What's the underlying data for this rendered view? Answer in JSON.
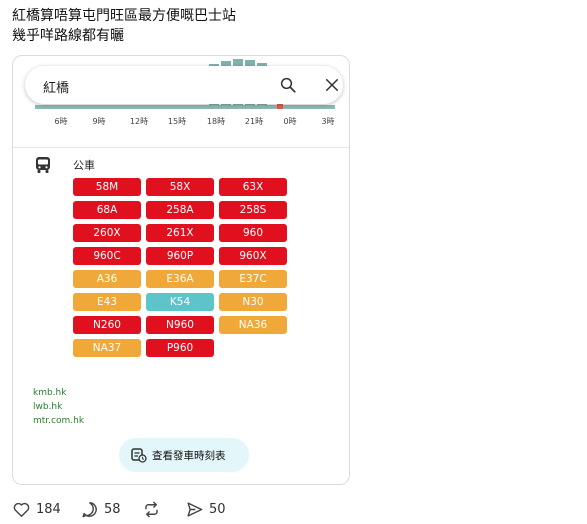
{
  "post": {
    "line1": "紅橋算唔算屯門旺區最方便嘅巴士站",
    "line2": "幾乎咩路線都有曬"
  },
  "map_card": {
    "search": {
      "value": "紅橋"
    },
    "busy_times": {
      "ticks": [
        "6時",
        "9時",
        "12時",
        "15時",
        "18時",
        "21時",
        "0時",
        "3時"
      ]
    },
    "transit": {
      "category": "公車",
      "routes": [
        {
          "label": "58M",
          "color": "#e0101f"
        },
        {
          "label": "58X",
          "color": "#e0101f"
        },
        {
          "label": "63X",
          "color": "#e0101f"
        },
        {
          "label": "68A",
          "color": "#e0101f"
        },
        {
          "label": "258A",
          "color": "#e0101f"
        },
        {
          "label": "258S",
          "color": "#e0101f"
        },
        {
          "label": "260X",
          "color": "#e0101f"
        },
        {
          "label": "261X",
          "color": "#e0101f"
        },
        {
          "label": "960",
          "color": "#e0101f"
        },
        {
          "label": "960C",
          "color": "#e0101f"
        },
        {
          "label": "960P",
          "color": "#e0101f"
        },
        {
          "label": "960X",
          "color": "#e0101f"
        },
        {
          "label": "A36",
          "color": "#f0a838"
        },
        {
          "label": "E36A",
          "color": "#f0a838"
        },
        {
          "label": "E37C",
          "color": "#f0a838"
        },
        {
          "label": "E43",
          "color": "#f0a838"
        },
        {
          "label": "K54",
          "color": "#5ec4cc"
        },
        {
          "label": "N30",
          "color": "#f0a838"
        },
        {
          "label": "N260",
          "color": "#e0101f"
        },
        {
          "label": "N960",
          "color": "#e0101f"
        },
        {
          "label": "NA36",
          "color": "#f0a838"
        },
        {
          "label": "NA37",
          "color": "#f0a838"
        },
        {
          "label": "P960",
          "color": "#e0101f"
        }
      ],
      "sources": [
        "kmb.hk",
        "lwb.hk",
        "mtr.com.hk"
      ],
      "timetable_button": "查看發車時刻表"
    }
  },
  "actions": {
    "likes": "184",
    "comments": "58",
    "shares": "50"
  }
}
